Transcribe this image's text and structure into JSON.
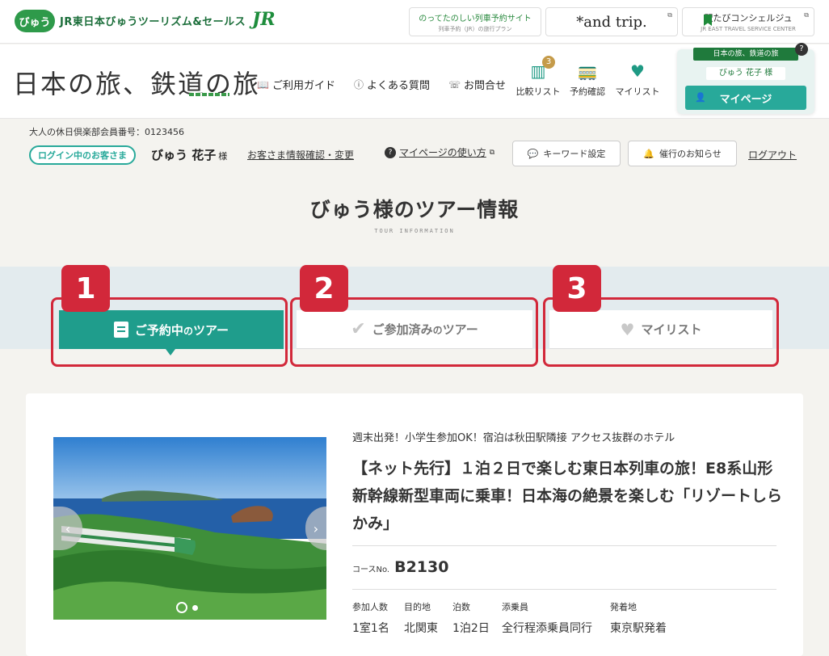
{
  "topbar": {
    "logo_text": "びゅう",
    "company": "JR東日本びゅうツーリズム&セールス",
    "jr_logo": "JR",
    "external_links": [
      {
        "main": "のってたのしい列車予約サイト",
        "sub": "列車予約（JR）の旅行プラン"
      },
      {
        "main": "*and trip.",
        "sub": ""
      },
      {
        "main": "駅たびコンシェルジュ",
        "sub": "JR EAST TRAVEL SERVICE CENTER"
      }
    ]
  },
  "header": {
    "site_logo": "日本の旅、鉄道の旅",
    "nav": {
      "guide": "ご利用ガイド",
      "faq": "よくある質問",
      "contact": "お問合せ"
    },
    "buttons": {
      "compare": "比較リスト",
      "compare_count": "3",
      "reserve": "予約確認",
      "mylist": "マイリスト"
    },
    "mypage": {
      "ribbon": "日本の旅、鉄道の旅",
      "name": "びゅう 花子 様",
      "button": "マイページ"
    }
  },
  "member": {
    "number_label": "大人の休日倶楽部会員番号：0123456",
    "login_badge": "ログイン中のお客さま",
    "name": "びゅう 花子",
    "honorific": "様",
    "info_link": "お客さま情報確認・変更",
    "howto_link": "マイページの使い方",
    "keyword_btn": "キーワード設定",
    "notice_btn": "催行のお知らせ",
    "logout": "ログアウト"
  },
  "page": {
    "title": "びゅう様のツアー情報",
    "subtitle": "TOUR INFORMATION"
  },
  "tabs": {
    "reserved_pre": "ご予約中",
    "reserved_small": "の",
    "reserved_post": "ツアー",
    "participated_pre": "ご参加済み",
    "participated_small": "の",
    "participated_post": "ツアー",
    "mylist": "マイリスト"
  },
  "annotations": [
    "1",
    "2",
    "3"
  ],
  "colors": {
    "accent": "#1f9d8c",
    "highlight": "#d2283a",
    "brand_green": "#1f7a3c"
  },
  "tour": {
    "catch": "週末出発！小学生参加OK！宿泊は秋田駅隣接 アクセス抜群のホテル",
    "title": "【ネット先行】１泊２日で楽しむ東日本列車の旅！E8系山形新幹線新型車両に乗車！日本海の絶景を楽しむ「リゾートしらかみ」",
    "course_label": "コースNo.",
    "course_no": "B2130",
    "attributes": [
      {
        "label": "参加人数",
        "value": "1室1名"
      },
      {
        "label": "目的地",
        "value": "北関東"
      },
      {
        "label": "泊数",
        "value": "1泊2日"
      },
      {
        "label": "添乗員",
        "value": "全行程添乗員同行"
      },
      {
        "label": "発着地",
        "value": "東京駅発着"
      }
    ]
  }
}
